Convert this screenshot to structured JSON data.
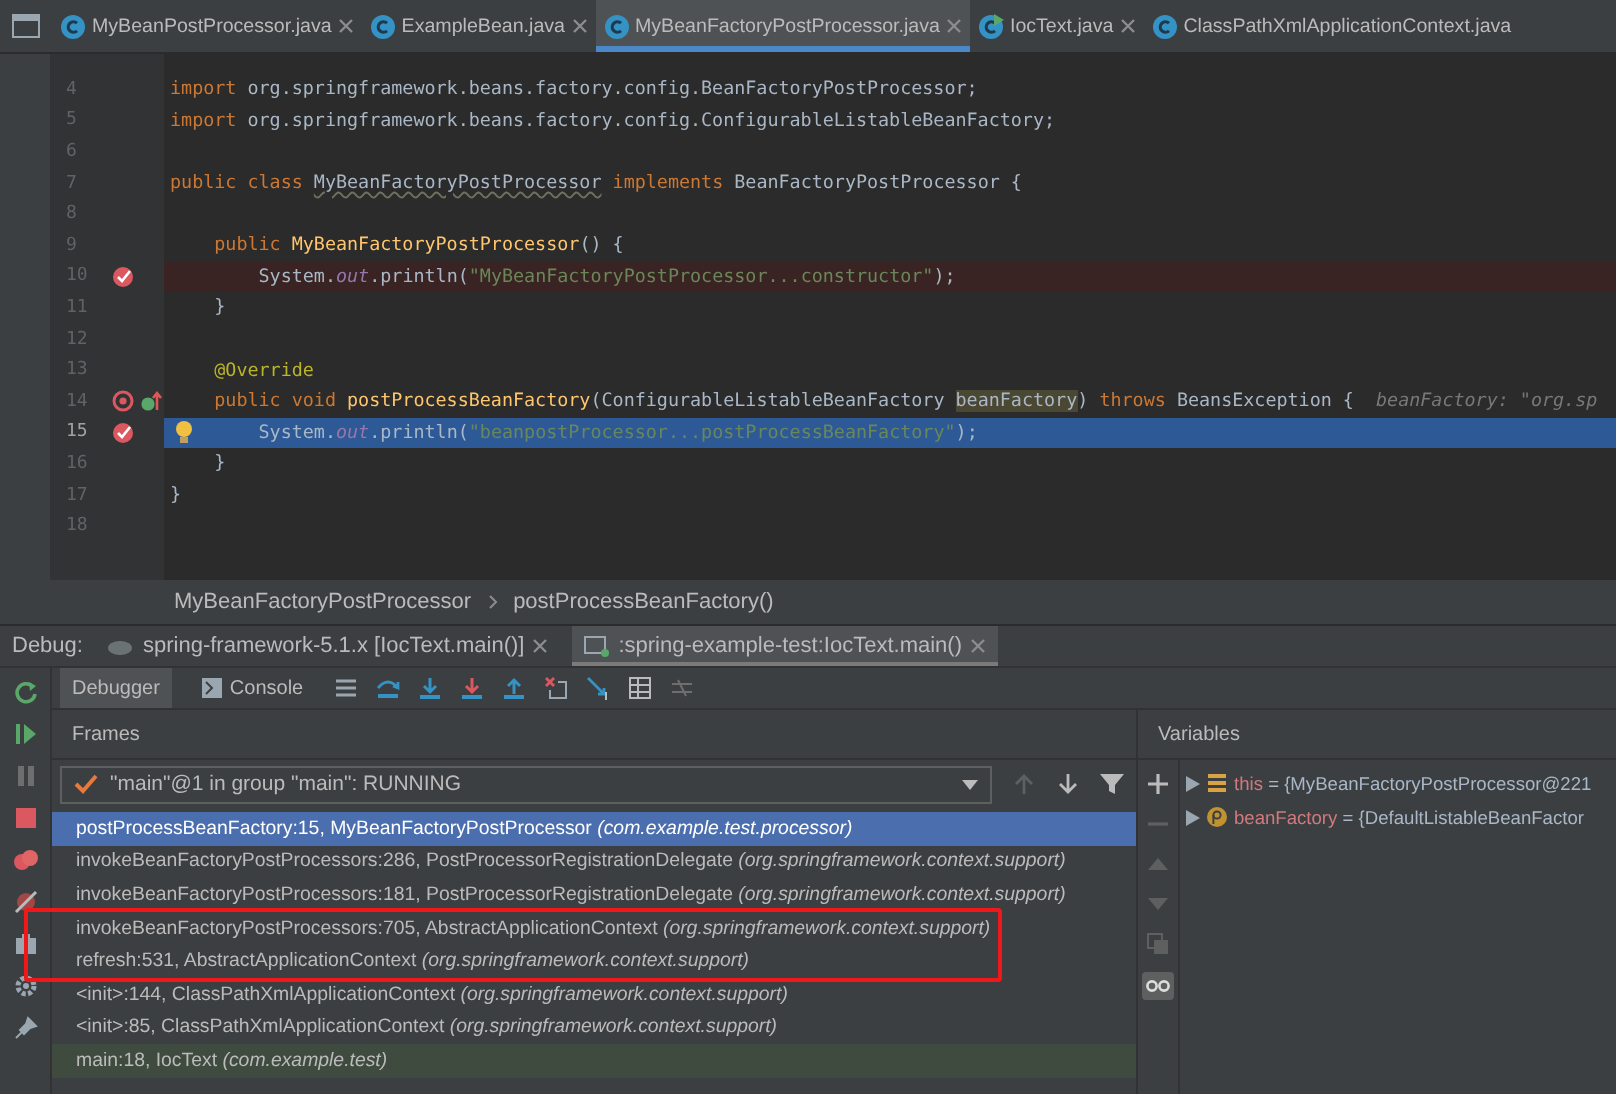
{
  "editor_tabs": [
    {
      "label": "MyBeanPostProcessor.java",
      "kind": "class",
      "selected": false,
      "closable": true
    },
    {
      "label": "ExampleBean.java",
      "kind": "class",
      "selected": false,
      "closable": true
    },
    {
      "label": "MyBeanFactoryPostProcessor.java",
      "kind": "class",
      "selected": true,
      "closable": true
    },
    {
      "label": "IocText.java",
      "kind": "runnable",
      "selected": false,
      "closable": true
    },
    {
      "label": "ClassPathXmlApplicationContext.java",
      "kind": "class",
      "selected": false,
      "closable": false
    }
  ],
  "code_lines": [
    {
      "number": "4",
      "breakpoint": false,
      "method_breakpoint": false,
      "current": false,
      "segments": [
        {
          "kind": "kw",
          "text": "import"
        },
        {
          "kind": "plain",
          "text": " org.springframework.beans.factory.config.BeanFactoryPostProcessor;"
        }
      ]
    },
    {
      "number": "5",
      "breakpoint": false,
      "method_breakpoint": false,
      "current": false,
      "segments": [
        {
          "kind": "kw",
          "text": "import"
        },
        {
          "kind": "plain",
          "text": " org.springframework.beans.factory.config.ConfigurableListableBeanFactory;"
        }
      ]
    },
    {
      "number": "6",
      "breakpoint": false,
      "method_breakpoint": false,
      "current": false
    },
    {
      "number": "7",
      "breakpoint": false,
      "method_breakpoint": false,
      "current": false,
      "segments": [
        {
          "kind": "kw",
          "text": "public class "
        },
        {
          "kind": "underlined",
          "text": "MyBeanFactoryPostProcessor"
        },
        {
          "kind": "kw",
          "text": " implements "
        },
        {
          "kind": "plain",
          "text": "BeanFactoryPostProcessor {"
        }
      ]
    },
    {
      "number": "8",
      "breakpoint": false,
      "method_breakpoint": false,
      "current": false
    },
    {
      "number": "9",
      "breakpoint": false,
      "method_breakpoint": false,
      "current": false,
      "segments": [
        {
          "kind": "kw",
          "text": "    public "
        },
        {
          "kind": "decl",
          "text": "MyBeanFactoryPostProcessor"
        },
        {
          "kind": "plain",
          "text": "() {"
        }
      ]
    },
    {
      "number": "10",
      "breakpoint": true,
      "method_breakpoint": false,
      "current": false,
      "segments": [
        {
          "kind": "plain",
          "text": "        System."
        },
        {
          "kind": "field",
          "text": "out"
        },
        {
          "kind": "plain",
          "text": ".println("
        },
        {
          "kind": "str",
          "text": "\"MyBeanFactoryPostProcessor...constructor\""
        },
        {
          "kind": "plain",
          "text": ");"
        }
      ]
    },
    {
      "number": "11",
      "breakpoint": false,
      "method_breakpoint": false,
      "current": false,
      "segments": [
        {
          "kind": "plain",
          "text": "    }"
        }
      ]
    },
    {
      "number": "12",
      "breakpoint": false,
      "method_breakpoint": false,
      "current": false
    },
    {
      "number": "13",
      "breakpoint": false,
      "method_breakpoint": false,
      "current": false,
      "segments": [
        {
          "kind": "ann",
          "text": "    @Override"
        }
      ]
    },
    {
      "number": "14",
      "breakpoint": false,
      "method_breakpoint": true,
      "current": false,
      "segments": [
        {
          "kind": "kw",
          "text": "    public void "
        },
        {
          "kind": "decl",
          "text": "postProcessBeanFactory"
        },
        {
          "kind": "plain",
          "text": "(ConfigurableListableBeanFactory "
        },
        {
          "kind": "param",
          "text": "beanFactory"
        },
        {
          "kind": "plain",
          "text": ") "
        },
        {
          "kind": "kw",
          "text": "throws "
        },
        {
          "kind": "plain",
          "text": "BeansException {"
        },
        {
          "kind": "hint",
          "text": "  beanFactory: \"org.sp"
        }
      ]
    },
    {
      "number": "15",
      "breakpoint": true,
      "method_breakpoint": false,
      "current": true,
      "segments": [
        {
          "kind": "plain",
          "text": "        System."
        },
        {
          "kind": "field",
          "text": "out"
        },
        {
          "kind": "plain",
          "text": ".println("
        },
        {
          "kind": "str",
          "text": "\"beanpostProcessor...postProcessBeanFactory\""
        },
        {
          "kind": "plain",
          "text": ");"
        }
      ]
    },
    {
      "number": "16",
      "breakpoint": false,
      "method_breakpoint": false,
      "current": false,
      "segments": [
        {
          "kind": "plain",
          "text": "    }"
        }
      ]
    },
    {
      "number": "17",
      "breakpoint": false,
      "method_breakpoint": false,
      "current": false,
      "segments": [
        {
          "kind": "plain",
          "text": "}"
        }
      ]
    },
    {
      "number": "18",
      "breakpoint": false,
      "method_breakpoint": false,
      "current": false
    }
  ],
  "breadcrumbs": [
    "MyBeanFactoryPostProcessor",
    "postProcessBeanFactory()"
  ],
  "debug": {
    "label": "Debug:",
    "sessions": [
      {
        "label": "spring-framework-5.1.x [IocText.main()]",
        "selected": false
      },
      {
        "label": ":spring-example-test:IocText.main()",
        "selected": true
      }
    ],
    "view_tabs": [
      {
        "label": "Debugger",
        "selected": true
      },
      {
        "label": "Console",
        "selected": false
      }
    ],
    "frames_title": "Frames",
    "thread": "\"main\"@1 in group \"main\": RUNNING",
    "frames": [
      {
        "text": "postProcessBeanFactory:15, MyBeanFactoryPostProcessor *(com.example.test.processor)*",
        "selected": true,
        "tinted": false,
        "boxed": false
      },
      {
        "text": "invokeBeanFactoryPostProcessors:286, PostProcessorRegistrationDelegate *(org.springframework.context.support)*",
        "selected": false,
        "tinted": false,
        "boxed": false
      },
      {
        "text": "invokeBeanFactoryPostProcessors:181, PostProcessorRegistrationDelegate *(org.springframework.context.support)*",
        "selected": false,
        "tinted": false,
        "boxed": false
      },
      {
        "text": "invokeBeanFactoryPostProcessors:705, AbstractApplicationContext *(org.springframework.context.support)*",
        "selected": false,
        "tinted": false,
        "boxed": true
      },
      {
        "text": "refresh:531, AbstractApplicationContext *(org.springframework.context.support)*",
        "selected": false,
        "tinted": false,
        "boxed": true
      },
      {
        "text": "<init>:144, ClassPathXmlApplicationContext *(org.springframework.context.support)*",
        "selected": false,
        "tinted": false,
        "boxed": false
      },
      {
        "text": "<init>:85, ClassPathXmlApplicationContext *(org.springframework.context.support)*",
        "selected": false,
        "tinted": false,
        "boxed": false
      },
      {
        "text": "main:18, IocText *(com.example.test)*",
        "selected": false,
        "tinted": true,
        "boxed": false
      }
    ],
    "variables_title": "Variables",
    "variables": [
      {
        "kind": "field",
        "name": "this",
        "value": "= {MyBeanFactoryPostProcessor@221"
      },
      {
        "kind": "param",
        "name": "beanFactory",
        "value": "= {DefaultListableBeanFactor"
      }
    ]
  }
}
